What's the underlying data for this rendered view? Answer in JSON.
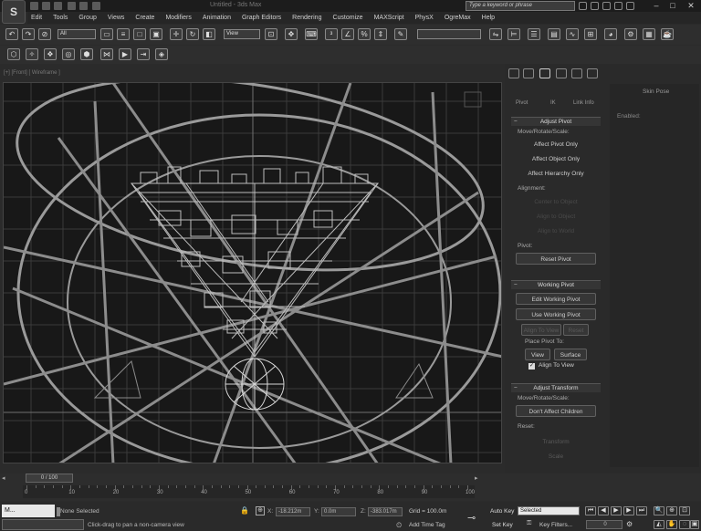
{
  "app": {
    "logo": "S",
    "title": "Untitled - 3ds Max",
    "search_placeholder": "Type a keyword or phrase"
  },
  "window": {
    "min": "–",
    "max": "□",
    "close": "✕"
  },
  "menu": [
    "Edit",
    "Tools",
    "Group",
    "Views",
    "Create",
    "Modifiers",
    "Animation",
    "Graph Editors",
    "Rendering",
    "Customize",
    "MAXScript",
    "PhysX",
    "OgreMax",
    "Help"
  ],
  "toolbar": {
    "filter_value": "All",
    "coord_value": "View"
  },
  "viewport": {
    "label": "[+] [Front] [ Wireframe ]"
  },
  "command_panel": {
    "tabs": [
      "Pivot",
      "IK",
      "Link Info"
    ],
    "adjust_pivot": {
      "header": "Adjust Pivot",
      "move_rotate_scale": "Move/Rotate/Scale:",
      "affect_pivot_only": "Affect Pivot Only",
      "affect_object_only": "Affect Object Only",
      "affect_hierarchy_only": "Affect Hierarchy Only",
      "alignment": "Alignment:",
      "center_to_object": "Center to Object",
      "align_to_object": "Align to Object",
      "align_to_world": "Align to World",
      "pivot": "Pivot:",
      "reset_pivot": "Reset Pivot"
    },
    "working_pivot": {
      "header": "Working Pivot",
      "edit_working_pivot": "Edit Working Pivot",
      "use_working_pivot": "Use Working Pivot",
      "align_to_view": "Align To View",
      "reset": "Reset",
      "place_pivot_to": "Place Pivot To:",
      "view": "View",
      "surface": "Surface",
      "align_to_view_check": "Align To View",
      "align_to_view_checked": true
    },
    "adjust_transform": {
      "header": "Adjust Transform",
      "move_rotate_scale": "Move/Rotate/Scale:",
      "dont_affect_children": "Don't Affect Children",
      "reset": "Reset:",
      "transform": "Transform",
      "scale": "Scale"
    }
  },
  "right_panel": {
    "skin_pose": "Skin Pose",
    "enabled": "Enabled:"
  },
  "timeline": {
    "slider": "0 / 100",
    "ticks": [
      "0",
      "10",
      "20",
      "30",
      "40",
      "50",
      "60",
      "70",
      "80",
      "90",
      "100"
    ]
  },
  "status": {
    "maxscript": "M...",
    "selection": "None Selected",
    "prompt": "Click-drag to pan a non-camera view",
    "x_label": "X:",
    "x_value": "-18.212m",
    "y_label": "Y:",
    "y_value": "0.0m",
    "z_label": "Z:",
    "z_value": "-383.017m",
    "grid": "Grid = 100.0m",
    "add_time_tag": "Add Time Tag",
    "auto_key": "Auto Key",
    "set_key": "Set Key",
    "selected": "Selected",
    "key_filters": "Key Filters...",
    "frame": "0"
  }
}
